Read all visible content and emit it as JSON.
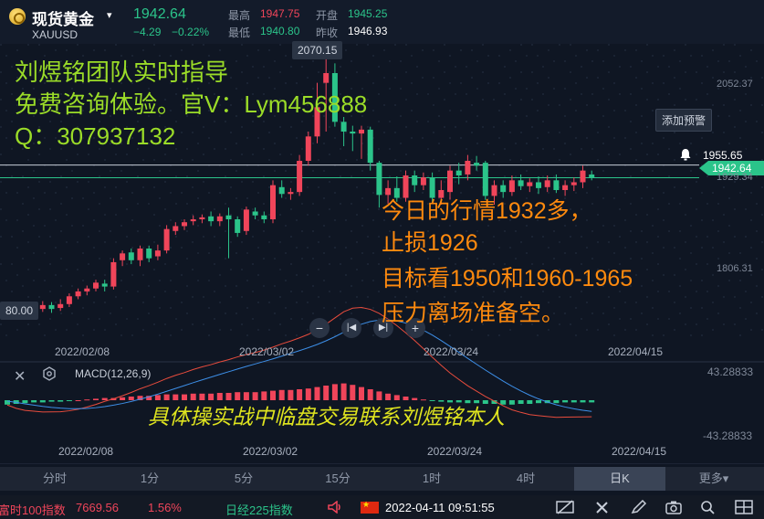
{
  "header": {
    "symbol_name": "现货黄金",
    "symbol_code": "XAUUSD",
    "caret": "▾",
    "price": "1942.64",
    "change": "−4.29",
    "change_pct": "−0.22%",
    "high_label": "最高",
    "high_value": "1947.75",
    "open_label": "开盘",
    "open_value": "1945.25",
    "low_label": "最低",
    "low_value": "1940.80",
    "prev_label": "昨收",
    "prev_value": "1946.93"
  },
  "chart": {
    "max_tag": "2070.15",
    "min_tag": "80.00",
    "alert_label": "添加预警",
    "alert_price": "1955.65",
    "current_price": "1942.64",
    "price_axis": [
      "2052.37",
      "1929.34",
      "1806.31"
    ],
    "date_axis_main": [
      "2022/02/08",
      "2022/03/02",
      "2022/03/24",
      "2022/04/15"
    ],
    "date_axis_macd": [
      "2022/02/08",
      "2022/03/02",
      "2022/03/24",
      "2022/04/15"
    ],
    "macd_label": "MACD(12,26,9)",
    "macd_top": "43.28833",
    "macd_bottom": "-43.28833",
    "zoom_out": "−",
    "zoom_prev": "|◀",
    "zoom_next": "▶|",
    "zoom_in": "+"
  },
  "overlays": {
    "title": "刘煜铭团队实时指导",
    "subtitle": "免费咨询体验。官V：Lym456888",
    "qq": "Q：307937132",
    "analysis_1": "今日的行情1932多，",
    "analysis_2": "止损1926",
    "analysis_3": "目标看1950和1960-1965",
    "analysis_4": "压力离场准备空。",
    "bottom_banner": "具体操实战中临盘交易联系刘煜铭本人"
  },
  "toolbar": {
    "periods": [
      "分时",
      "1分",
      "5分",
      "15分",
      "1时",
      "4时",
      "日K",
      "更多▾"
    ],
    "active_index": 6
  },
  "statusbar": {
    "index1_name": "富时100指数",
    "index1_value": "7669.56",
    "index1_pct": "1.56%",
    "index2_name": "日经225指数",
    "datetime": "2022-04-11  09:51:55"
  },
  "colors": {
    "up": "#f0455a",
    "down": "#2bc48a",
    "bg": "#0f1623",
    "accent_green": "#9bdc28",
    "accent_orange": "#ff8a0e"
  },
  "chart_data": {
    "type": "candlestick",
    "y_range": [
      1780,
      2080
    ],
    "candles": [
      {
        "o": 1804,
        "c": 1808,
        "h": 1811,
        "l": 1797
      },
      {
        "o": 1808,
        "c": 1805,
        "h": 1812,
        "l": 1801
      },
      {
        "o": 1805,
        "c": 1810,
        "h": 1813,
        "l": 1802
      },
      {
        "o": 1810,
        "c": 1807,
        "h": 1814,
        "l": 1803
      },
      {
        "o": 1808,
        "c": 1812,
        "h": 1816,
        "l": 1805
      },
      {
        "o": 1812,
        "c": 1808,
        "h": 1815,
        "l": 1804
      },
      {
        "o": 1809,
        "c": 1813,
        "h": 1818,
        "l": 1806
      },
      {
        "o": 1813,
        "c": 1821,
        "h": 1824,
        "l": 1810
      },
      {
        "o": 1821,
        "c": 1826,
        "h": 1829,
        "l": 1818
      },
      {
        "o": 1826,
        "c": 1829,
        "h": 1832,
        "l": 1822
      },
      {
        "o": 1829,
        "c": 1835,
        "h": 1838,
        "l": 1826
      },
      {
        "o": 1834,
        "c": 1831,
        "h": 1838,
        "l": 1826
      },
      {
        "o": 1831,
        "c": 1856,
        "h": 1860,
        "l": 1828
      },
      {
        "o": 1858,
        "c": 1865,
        "h": 1868,
        "l": 1852
      },
      {
        "o": 1866,
        "c": 1858,
        "h": 1870,
        "l": 1854
      },
      {
        "o": 1858,
        "c": 1870,
        "h": 1873,
        "l": 1852
      },
      {
        "o": 1870,
        "c": 1860,
        "h": 1873,
        "l": 1856
      },
      {
        "o": 1862,
        "c": 1868,
        "h": 1874,
        "l": 1858
      },
      {
        "o": 1868,
        "c": 1890,
        "h": 1894,
        "l": 1865
      },
      {
        "o": 1888,
        "c": 1893,
        "h": 1897,
        "l": 1884
      },
      {
        "o": 1893,
        "c": 1897,
        "h": 1900,
        "l": 1889
      },
      {
        "o": 1898,
        "c": 1900,
        "h": 1904,
        "l": 1894
      },
      {
        "o": 1900,
        "c": 1902,
        "h": 1905,
        "l": 1896
      },
      {
        "o": 1903,
        "c": 1898,
        "h": 1908,
        "l": 1893
      },
      {
        "o": 1898,
        "c": 1903,
        "h": 1906,
        "l": 1893
      },
      {
        "o": 1904,
        "c": 1900,
        "h": 1912,
        "l": 1860
      },
      {
        "o": 1900,
        "c": 1886,
        "h": 1903,
        "l": 1882
      },
      {
        "o": 1888,
        "c": 1910,
        "h": 1913,
        "l": 1884
      },
      {
        "o": 1908,
        "c": 1904,
        "h": 1912,
        "l": 1900
      },
      {
        "o": 1904,
        "c": 1900,
        "h": 1908,
        "l": 1896
      },
      {
        "o": 1900,
        "c": 1935,
        "h": 1940,
        "l": 1896
      },
      {
        "o": 1933,
        "c": 1926,
        "h": 1940,
        "l": 1922
      },
      {
        "o": 1926,
        "c": 1928,
        "h": 1932,
        "l": 1920
      },
      {
        "o": 1928,
        "c": 1960,
        "h": 1966,
        "l": 1924
      },
      {
        "o": 1960,
        "c": 1985,
        "h": 1990,
        "l": 1955
      },
      {
        "o": 1985,
        "c": 2015,
        "h": 2040,
        "l": 1978
      },
      {
        "o": 2040,
        "c": 2050,
        "h": 2070,
        "l": 1990
      },
      {
        "o": 2050,
        "c": 2000,
        "h": 2060,
        "l": 1995
      },
      {
        "o": 2000,
        "c": 1990,
        "h": 2005,
        "l": 1975
      },
      {
        "o": 1990,
        "c": 1988,
        "h": 1996,
        "l": 1970
      },
      {
        "o": 1988,
        "c": 1992,
        "h": 1996,
        "l": 1962
      },
      {
        "o": 1992,
        "c": 1958,
        "h": 1995,
        "l": 1950
      },
      {
        "o": 1958,
        "c": 1925,
        "h": 1960,
        "l": 1912
      },
      {
        "o": 1925,
        "c": 1932,
        "h": 1940,
        "l": 1916
      },
      {
        "o": 1932,
        "c": 1922,
        "h": 1944,
        "l": 1918
      },
      {
        "o": 1922,
        "c": 1945,
        "h": 1950,
        "l": 1918
      },
      {
        "o": 1945,
        "c": 1935,
        "h": 1950,
        "l": 1928
      },
      {
        "o": 1935,
        "c": 1943,
        "h": 1948,
        "l": 1930
      },
      {
        "o": 1943,
        "c": 1922,
        "h": 1948,
        "l": 1918
      },
      {
        "o": 1922,
        "c": 1930,
        "h": 1940,
        "l": 1915
      },
      {
        "o": 1928,
        "c": 1950,
        "h": 1955,
        "l": 1920
      },
      {
        "o": 1950,
        "c": 1945,
        "h": 1958,
        "l": 1936
      },
      {
        "o": 1946,
        "c": 1960,
        "h": 1966,
        "l": 1940
      },
      {
        "o": 1958,
        "c": 1955,
        "h": 1965,
        "l": 1950
      },
      {
        "o": 1958,
        "c": 1924,
        "h": 1960,
        "l": 1920
      },
      {
        "o": 1924,
        "c": 1935,
        "h": 1940,
        "l": 1915
      },
      {
        "o": 1935,
        "c": 1928,
        "h": 1940,
        "l": 1922
      },
      {
        "o": 1928,
        "c": 1940,
        "h": 1945,
        "l": 1924
      },
      {
        "o": 1940,
        "c": 1934,
        "h": 1946,
        "l": 1930
      },
      {
        "o": 1934,
        "c": 1938,
        "h": 1942,
        "l": 1928
      },
      {
        "o": 1938,
        "c": 1932,
        "h": 1944,
        "l": 1926
      },
      {
        "o": 1933,
        "c": 1940,
        "h": 1945,
        "l": 1928
      },
      {
        "o": 1940,
        "c": 1930,
        "h": 1946,
        "l": 1927
      },
      {
        "o": 1930,
        "c": 1935,
        "h": 1940,
        "l": 1924
      },
      {
        "o": 1935,
        "c": 1938,
        "h": 1943,
        "l": 1929
      },
      {
        "o": 1938,
        "c": 1950,
        "h": 1955,
        "l": 1932
      },
      {
        "o": 1946,
        "c": 1943,
        "h": 1950,
        "l": 1940
      }
    ],
    "macd_hist": [
      -6,
      -5,
      -4,
      -3,
      -3,
      -2,
      -2,
      -1,
      0,
      1,
      2,
      3,
      3,
      4,
      5,
      6,
      6,
      7,
      8,
      8,
      8,
      9,
      9,
      9,
      10,
      10,
      11,
      11,
      11,
      12,
      13,
      14,
      14,
      15,
      16,
      18,
      20,
      22,
      23,
      21,
      18,
      15,
      12,
      9,
      7,
      5,
      3,
      1,
      -1,
      -2,
      -3,
      -3,
      -4,
      -4,
      -5,
      -5,
      -6,
      -6,
      -5,
      -5,
      -4,
      -4,
      -4,
      -3,
      -3,
      -3,
      -3
    ]
  }
}
